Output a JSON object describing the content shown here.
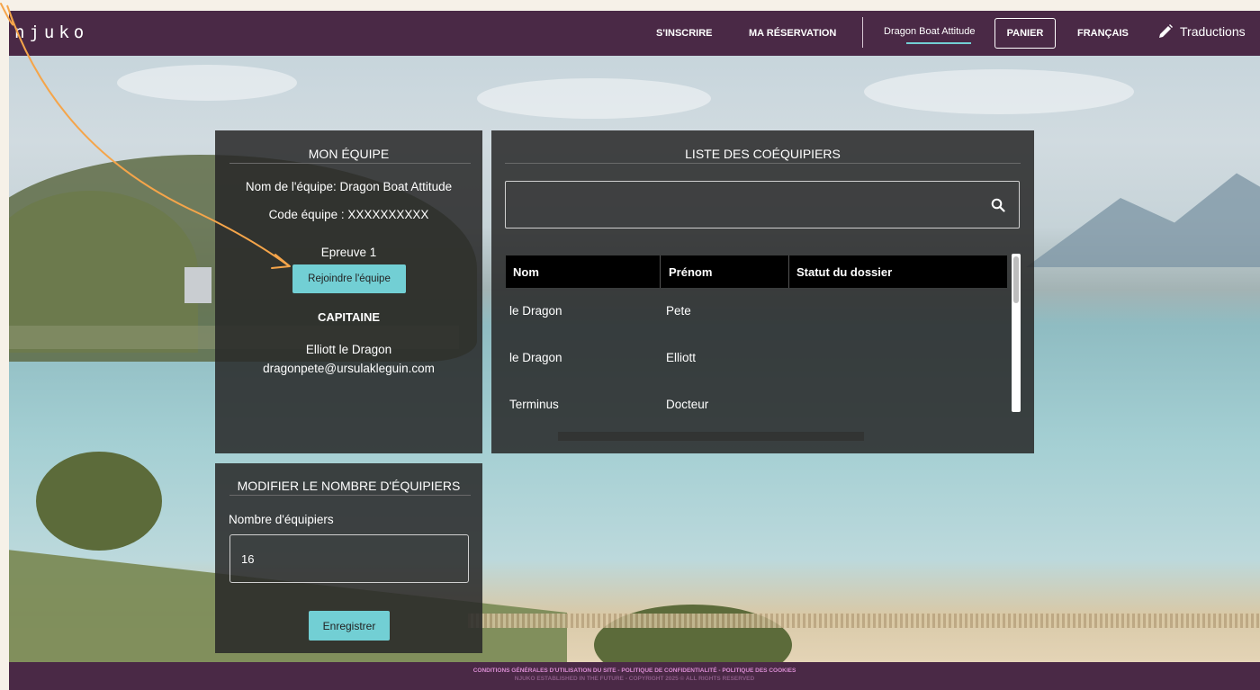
{
  "header": {
    "logo": "njuko",
    "nav": [
      "S'INSCRIRE",
      "MA RÉSERVATION"
    ],
    "team_link": "Dragon Boat Attitude",
    "cart": "PANIER",
    "language": "FRANÇAIS",
    "translations": "Traductions"
  },
  "my_team": {
    "title": "MON ÉQUIPE",
    "team_name": "Nom de l'équipe: Dragon Boat Attitude",
    "team_code": "Code équipe : XXXXXXXXXX",
    "event": "Epreuve 1",
    "join_button": "Rejoindre l'équipe",
    "captain_label": "CAPITAINE",
    "captain_name": "Elliott le Dragon",
    "captain_email": "dragonpete@ursulakleguin.com"
  },
  "teammates": {
    "title": "LISTE DES COÉQUIPIERS",
    "search_value": "",
    "columns": [
      "Nom",
      "Prénom",
      "Statut du dossier"
    ],
    "rows": [
      {
        "nom": "le Dragon",
        "prenom": "Pete",
        "statut": ""
      },
      {
        "nom": "le Dragon",
        "prenom": "Elliott",
        "statut": ""
      },
      {
        "nom": "Terminus",
        "prenom": "Docteur",
        "statut": ""
      }
    ]
  },
  "modify": {
    "title": "MODIFIER LE NOMBRE D'ÉQUIPIERS",
    "label": "Nombre d'équipiers",
    "value": "16",
    "save_button": "Enregistrer"
  },
  "footer": {
    "links": [
      "CONDITIONS GÉNÉRALES D'UTILISATION DU SITE",
      "POLITIQUE DE CONFIDENTIALITÉ",
      "POLITIQUE DES COOKIES"
    ],
    "separator": " - ",
    "copyright": "NJUKO ESTABLISHED IN THE FUTURE - COPYRIGHT 2025 © ALL RIGHTS RESERVED"
  },
  "colors": {
    "header_bg": "#4a2946",
    "accent_teal": "#72cfd4",
    "annotation_arrow": "#f5a54a"
  },
  "icons": [
    "pencil-icon",
    "search-icon",
    "annotation-arrow"
  ]
}
